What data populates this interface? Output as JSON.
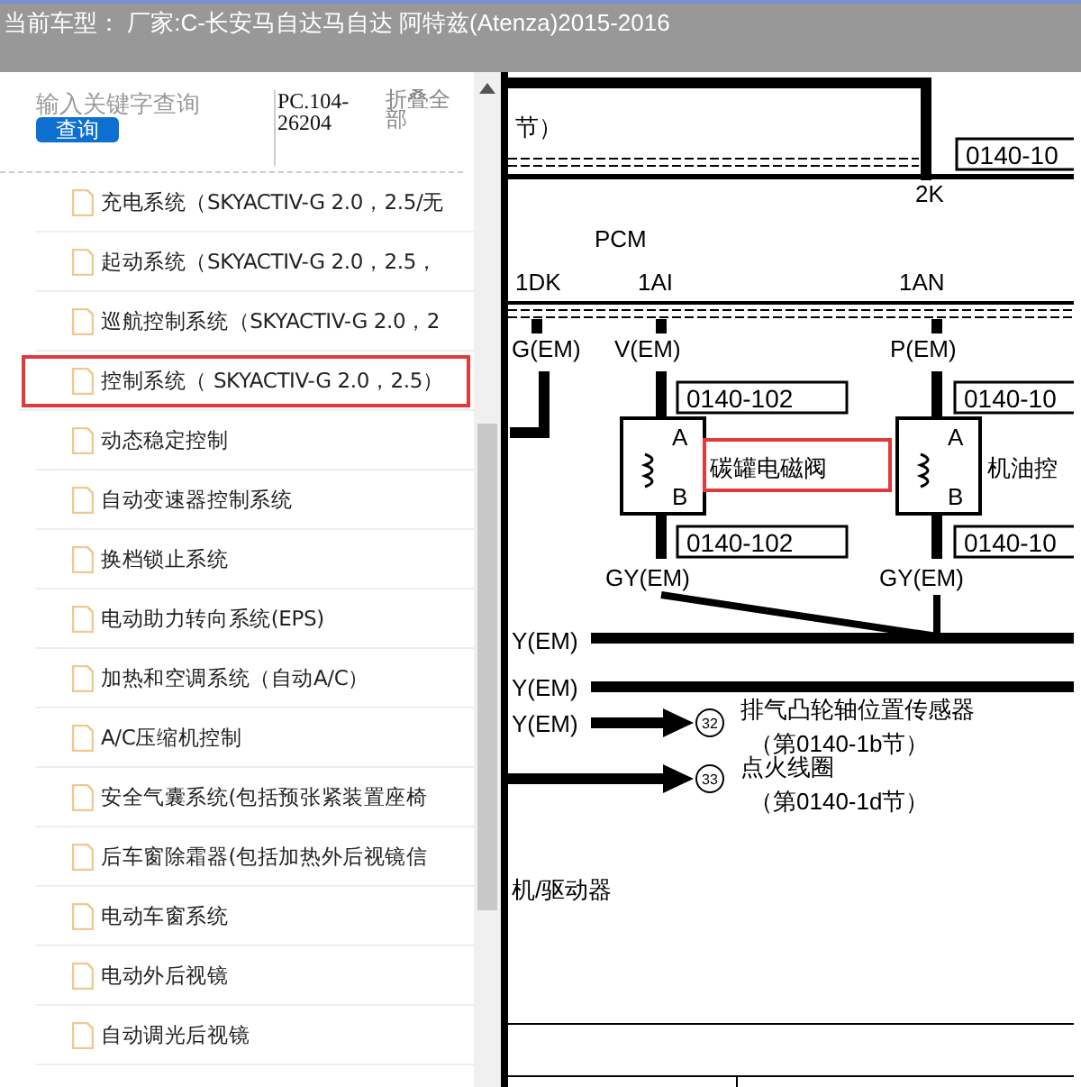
{
  "header": {
    "title": "当前车型： 厂家:C-长安马自达马自达 阿特兹(Atenza)2015-2016"
  },
  "toolbar": {
    "search": {
      "placeholder": "输入关键字查询"
    },
    "search_button": "查询",
    "code": "PC.104-26204",
    "collapse_all": "折叠全部"
  },
  "tree": [
    {
      "label": "充电系统（SKYACTIV-G 2.0，2.5/无",
      "highlighted": false
    },
    {
      "label": "起动系统（SKYACTIV-G 2.0，2.5，",
      "highlighted": false
    },
    {
      "label": "巡航控制系统（SKYACTIV-G 2.0，2",
      "highlighted": false
    },
    {
      "label": "控制系统（ SKYACTIV-G 2.0，2.5）",
      "highlighted": true
    },
    {
      "label": "动态稳定控制",
      "highlighted": false
    },
    {
      "label": "自动变速器控制系统",
      "highlighted": false
    },
    {
      "label": "换档锁止系统",
      "highlighted": false
    },
    {
      "label": "电动助力转向系统(EPS)",
      "highlighted": false
    },
    {
      "label": "加热和空调系统（自动A/C）",
      "highlighted": false
    },
    {
      "label": "A/C压缩机控制",
      "highlighted": false
    },
    {
      "label": "安全气囊系统(包括预张紧装置座椅",
      "highlighted": false
    },
    {
      "label": "后车窗除霜器(包括加热外后视镜信",
      "highlighted": false
    },
    {
      "label": "电动车窗系统",
      "highlighted": false
    },
    {
      "label": "电动外后视镜",
      "highlighted": false
    },
    {
      "label": "自动调光后视镜",
      "highlighted": false
    }
  ],
  "diagram": {
    "labels": [
      {
        "text": "节）",
        "highlighted": false
      },
      {
        "text": "0140-10",
        "highlighted": false
      },
      {
        "text": "2K",
        "highlighted": false
      },
      {
        "text": "PCM",
        "highlighted": false
      },
      {
        "text": "1DK",
        "highlighted": false
      },
      {
        "text": "1AI",
        "highlighted": false
      },
      {
        "text": "1AN",
        "highlighted": false
      },
      {
        "text": "G(EM)",
        "highlighted": false
      },
      {
        "text": "V(EM)",
        "highlighted": false
      },
      {
        "text": "P(EM)",
        "highlighted": false
      },
      {
        "text": "0140-102",
        "highlighted": false
      },
      {
        "text": "0140-10",
        "highlighted": false
      },
      {
        "text": "A",
        "highlighted": false
      },
      {
        "text": "B",
        "highlighted": false
      },
      {
        "text": "A",
        "highlighted": false
      },
      {
        "text": "B",
        "highlighted": false
      },
      {
        "text": "碳罐电磁阀",
        "highlighted": true
      },
      {
        "text": "机油控",
        "highlighted": false
      },
      {
        "text": "0140-102",
        "highlighted": false
      },
      {
        "text": "0140-10",
        "highlighted": false
      },
      {
        "text": "GY(EM)",
        "highlighted": false
      },
      {
        "text": "GY(EM)",
        "highlighted": false
      },
      {
        "text": "Y(EM)",
        "highlighted": false
      },
      {
        "text": "Y(EM)",
        "highlighted": false
      },
      {
        "text": "Y(EM)",
        "highlighted": false
      },
      {
        "text": "32",
        "highlighted": false
      },
      {
        "text": "排气凸轮轴位置传感器",
        "highlighted": false
      },
      {
        "text": "（第0140-1b节）",
        "highlighted": false
      },
      {
        "text": "33",
        "highlighted": false
      },
      {
        "text": "点火线圈",
        "highlighted": false
      },
      {
        "text": "（第0140-1d节）",
        "highlighted": false
      },
      {
        "text": "机/驱动器",
        "highlighted": false
      }
    ]
  }
}
